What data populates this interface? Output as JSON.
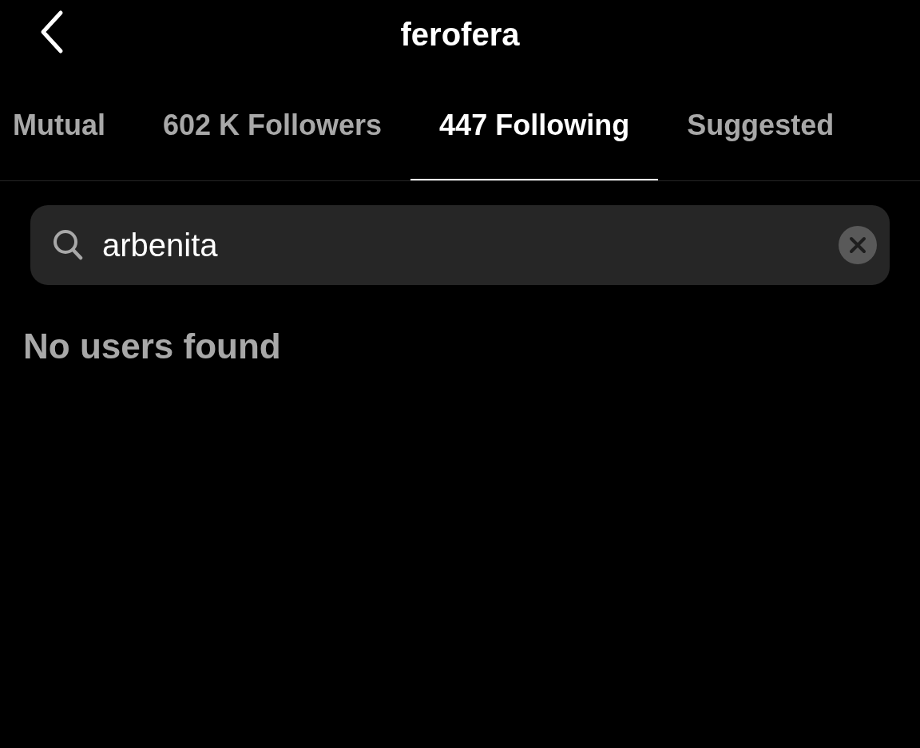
{
  "header": {
    "title": "ferofera"
  },
  "tabs": [
    {
      "label": "Mutual",
      "selected": false
    },
    {
      "label": "602 K Followers",
      "selected": false
    },
    {
      "label": "447 Following",
      "selected": true
    },
    {
      "label": "Suggested",
      "selected": false
    }
  ],
  "search": {
    "value": "arbenita"
  },
  "empty_message": "No users found"
}
